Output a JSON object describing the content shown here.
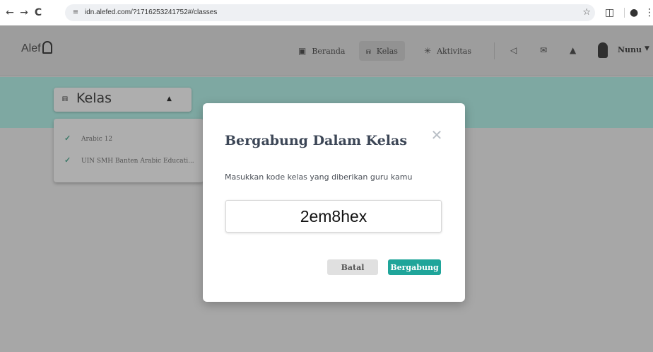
{
  "browser": {
    "back_icon": "←",
    "forward_icon": "→",
    "reload_icon": "C",
    "site_icon": "≡",
    "url": "idn.alefed.com/?1716253241752#/classes",
    "star_icon": "☆",
    "extensions_icon": "◫",
    "profile_icon": "●",
    "menu_icon": "⋮"
  },
  "header": {
    "logo_text": "Alef",
    "nav": [
      {
        "icon": "▣",
        "label": "Beranda"
      },
      {
        "icon": "⩎",
        "label": "Kelas"
      },
      {
        "icon": "✳",
        "label": "Aktivitas"
      }
    ],
    "icons": {
      "announce": "◁",
      "mail": "✉",
      "bell": "▲"
    },
    "user_name": "Nunu",
    "user_caret": "▼"
  },
  "kelas": {
    "icon": "⩎",
    "label": "Kelas",
    "caret": "▲",
    "items": [
      {
        "check": "✓",
        "label": "Arabic 12"
      },
      {
        "check": "✓",
        "label": "UIN SMH Banten Arabic Educati..."
      }
    ]
  },
  "modal": {
    "title": "Bergabung Dalam Kelas",
    "close_icon": "✕",
    "description": "Masukkan kode kelas yang diberikan guru kamu",
    "code_value": "2em8hex",
    "cancel_label": "Batal",
    "join_label": "Bergabung"
  },
  "colors": {
    "accent": "#1fa59a",
    "band": "#7ea8a2",
    "overlay": "#a7a7a7"
  }
}
